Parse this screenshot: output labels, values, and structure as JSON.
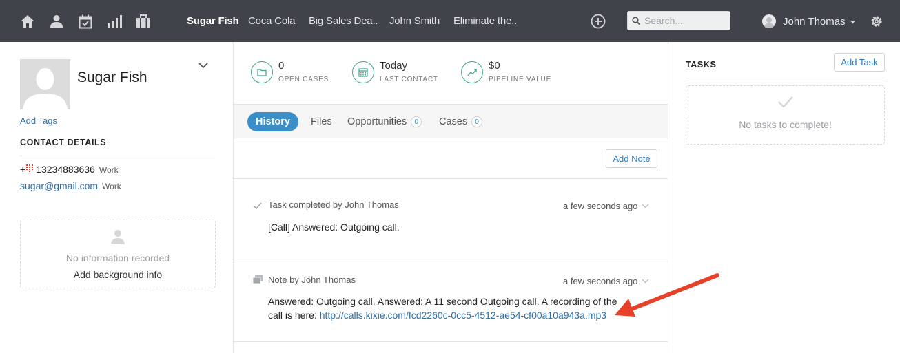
{
  "nav": {
    "icons": [
      "home-icon",
      "person-icon",
      "calendar-check-icon",
      "bar-chart-icon",
      "briefcase-icon"
    ],
    "tabs": [
      "Sugar Fish",
      "Coca Cola",
      "Big Sales Dea..",
      "John Smith",
      "Eliminate the.."
    ],
    "active_tab": "Sugar Fish",
    "search_placeholder": "Search...",
    "user_name": "John Thomas"
  },
  "contact": {
    "name": "Sugar Fish",
    "add_tags": "Add Tags",
    "details_title": "CONTACT DETAILS",
    "phone_prefix": "+",
    "phone": "13234883636",
    "phone_type": "Work",
    "email": "sugar@gmail.com",
    "email_type": "Work",
    "background_empty": "No information recorded",
    "background_add": "Add background info"
  },
  "stats": [
    {
      "value": "0",
      "label": "OPEN CASES",
      "icon": "folder-icon"
    },
    {
      "value": "Today",
      "label": "LAST CONTACT",
      "icon": "calendar-icon"
    },
    {
      "value": "$0",
      "label": "PIPELINE VALUE",
      "icon": "trend-line-icon"
    }
  ],
  "panel_tabs": {
    "history": "History",
    "files": "Files",
    "opportunities": "Opportunities",
    "opportunities_count": "0",
    "cases": "Cases",
    "cases_count": "0"
  },
  "add_note": "Add Note",
  "history": [
    {
      "icon": "checkmark-icon",
      "title": "Task completed by John Thomas",
      "time": "a few seconds ago",
      "body": "[Call] Answered: Outgoing call."
    },
    {
      "icon": "note-icon",
      "title": "Note by John Thomas",
      "time": "a few seconds ago",
      "body_line1": "Answered: Outgoing call. Answered: A 11 second Outgoing call. A recording of the",
      "body_line2_prefix": "call is here: ",
      "link": "http://calls.kixie.com/fcd2260c-0cc5-4512-ae54-cf00a10a943a.mp3"
    }
  ],
  "tasks": {
    "title": "TASKS",
    "add_task": "Add Task",
    "empty": "No tasks to complete!"
  },
  "colors": {
    "topbar": "#40434a",
    "active_tab_pill": "#3b8fc8",
    "link": "#2f6fa7",
    "stat_icon": "#3fa58b",
    "annotation_arrow": "#e8412a"
  }
}
